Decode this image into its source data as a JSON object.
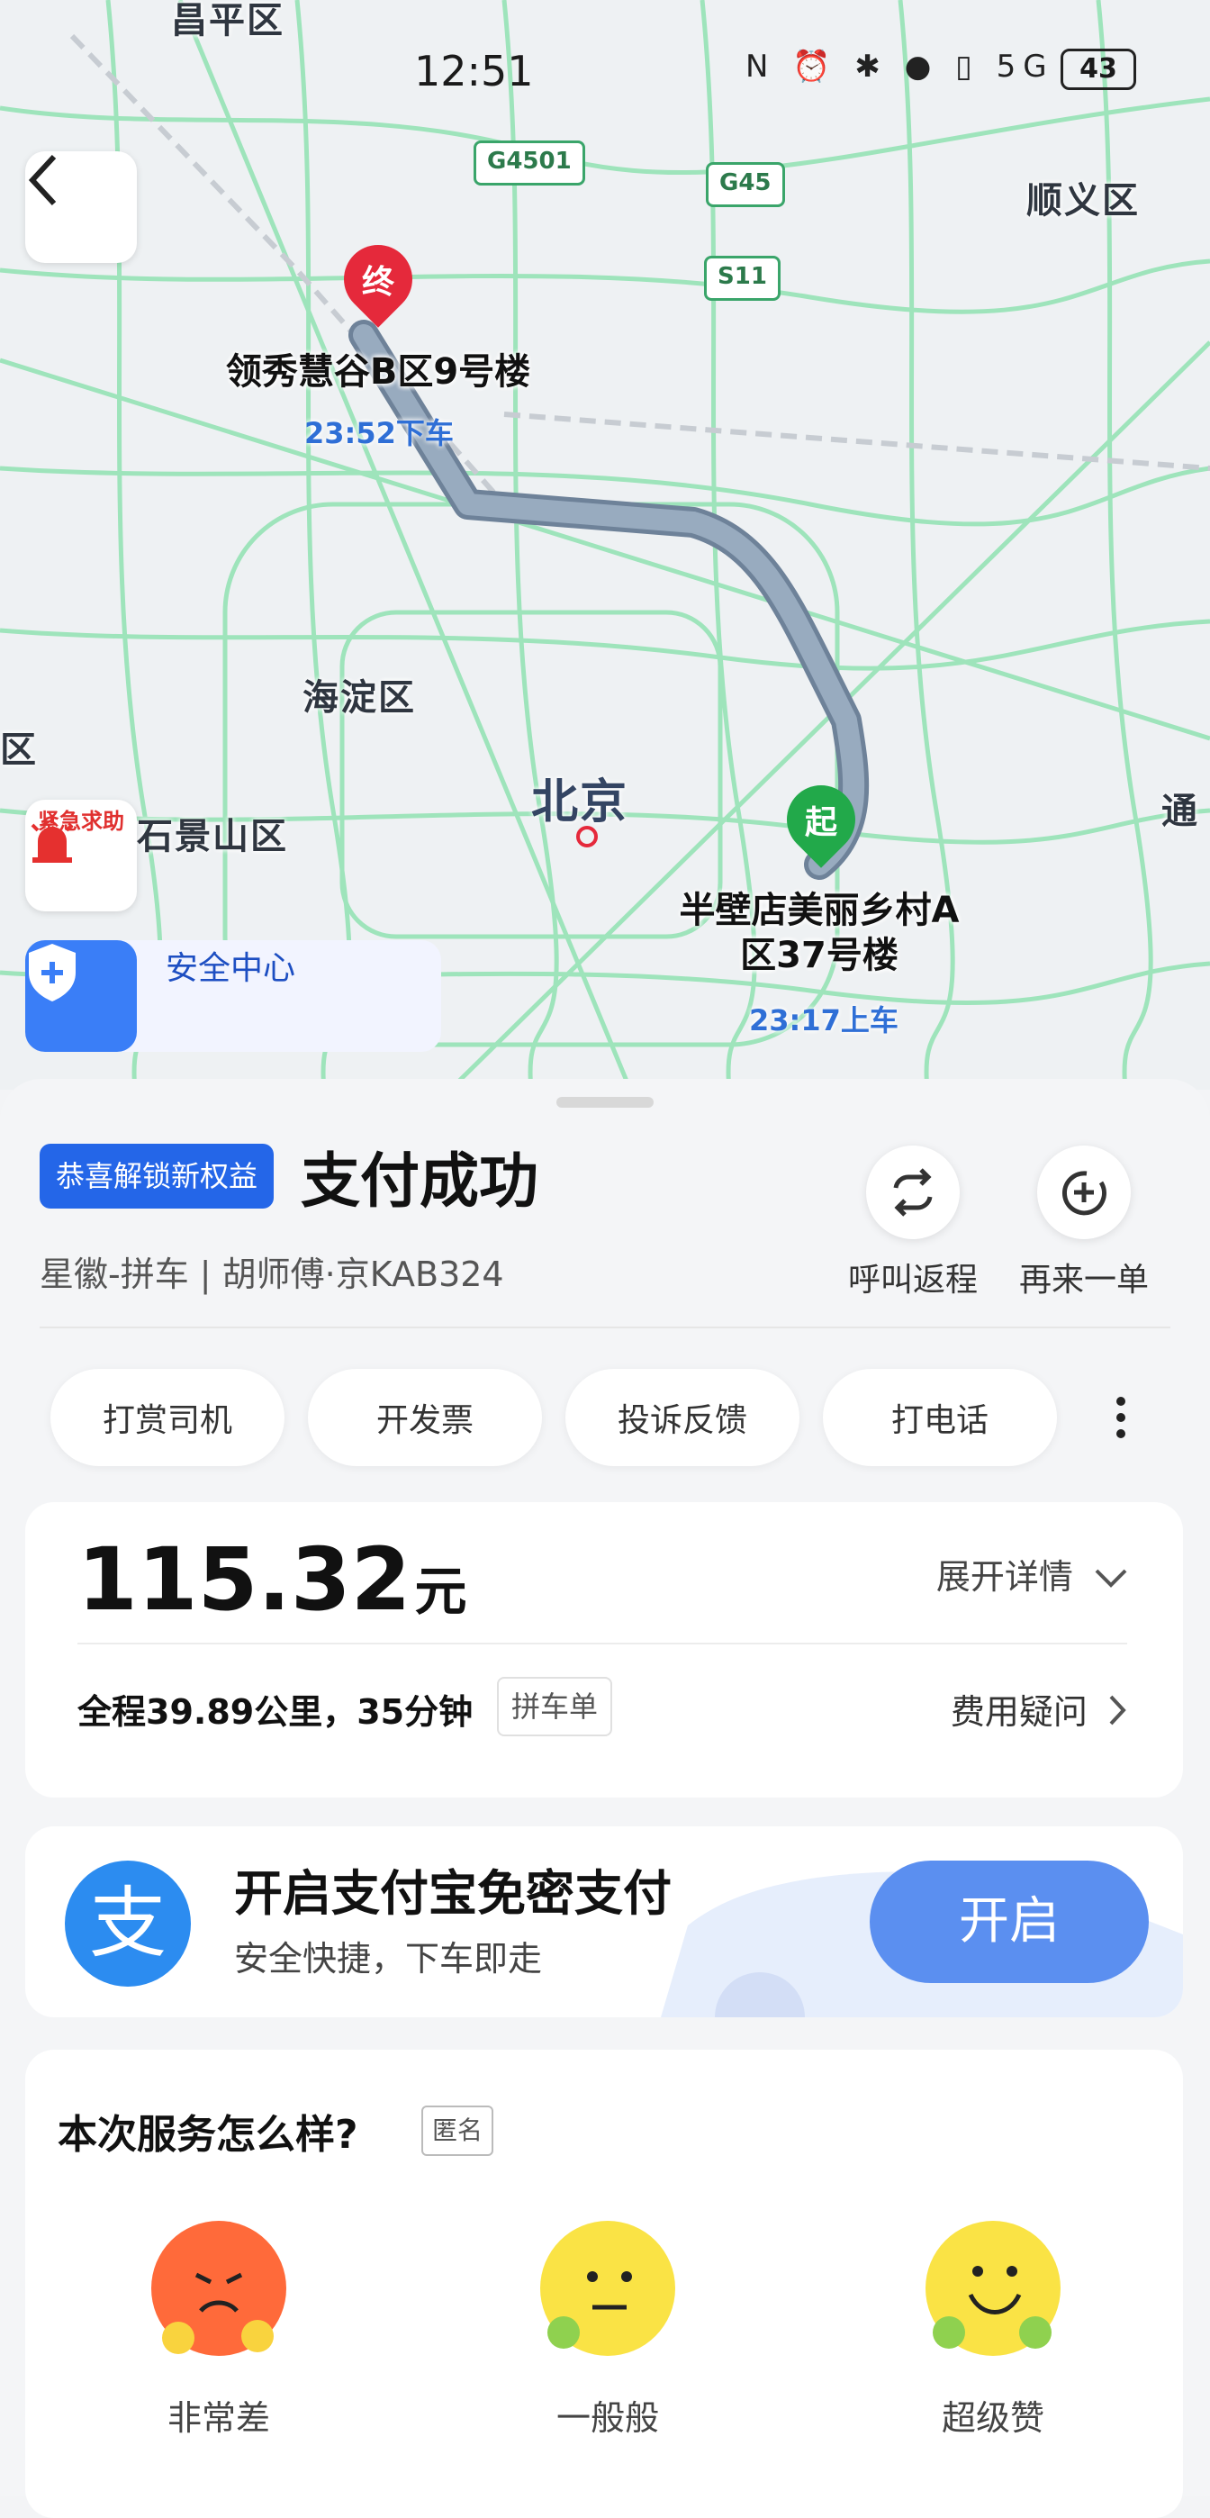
{
  "status_bar": {
    "time": "12:51",
    "icons": "N ⏰ ✱ ● ▯ 5G",
    "battery": "43"
  },
  "map": {
    "districts": [
      "昌平区",
      "顺义区",
      "海淀区",
      "北京",
      "石景山区",
      "通",
      "区"
    ],
    "road_signs": [
      "G4501",
      "G45",
      "S11"
    ],
    "destination": {
      "pin": "终",
      "name": "领秀慧谷B区9号楼",
      "time": "23:52下车"
    },
    "origin": {
      "pin": "起",
      "name_line1": "半壁店美丽乡村A",
      "name_line2": "区37号楼",
      "time": "23:17上车"
    },
    "sos_label": "紧急求助",
    "safety_label": "安全中心"
  },
  "order": {
    "badge": "恭喜解锁新权益",
    "title": "支付成功",
    "subtitle": "星徽-拼车 | 胡师傅·京KAB324",
    "return_label": "呼叫返程",
    "again_label": "再来一单"
  },
  "actions": [
    "打赏司机",
    "开发票",
    "投诉反馈",
    "打电话"
  ],
  "fare": {
    "amount": "115.32",
    "unit": "元",
    "expand_label": "展开详情",
    "trip_info": "全程39.89公里，35分钟",
    "tag": "拼车单",
    "fee_question": "费用疑问"
  },
  "alipay": {
    "logo": "支",
    "title": "开启支付宝免密支付",
    "subtitle": "安全快捷，下车即走",
    "button": "开启"
  },
  "rating": {
    "title": "本次服务怎么样?",
    "anonymous": "匿名",
    "options": [
      "非常差",
      "一般般",
      "超级赞"
    ]
  },
  "colors": {
    "accent": "#2466e8",
    "road": "#7ad8a3",
    "route": "#8d9fb3",
    "start_pin": "#22a94a",
    "end_pin": "#e5293b"
  }
}
